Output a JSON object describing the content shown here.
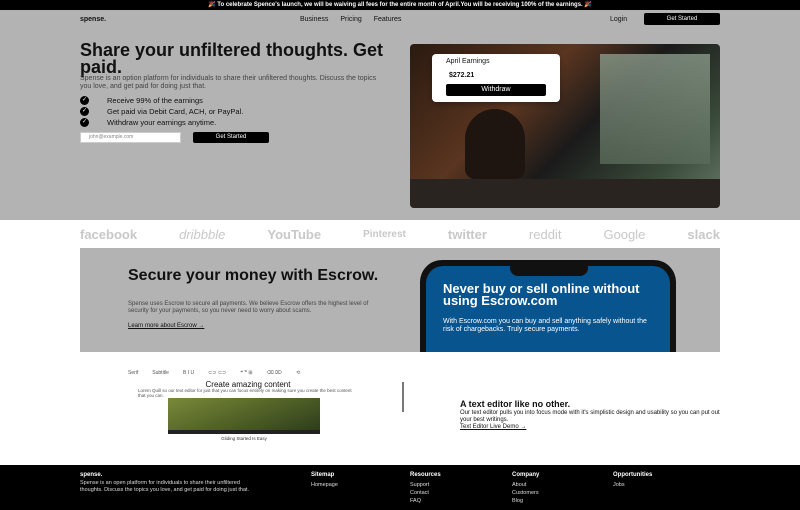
{
  "announcement": "🎉 To celebrate Spence's launch, we will be waiving all fees for the entire month of April.You will be receiving 100% of the earnings. 🎉",
  "nav": {
    "logo": "spense.",
    "links": [
      "Business",
      "Pricing",
      "Features"
    ],
    "login": "Login",
    "cta": "Get Started"
  },
  "hero": {
    "title": "Share your unfiltered thoughts. Get paid.",
    "subtitle": "Spense is an option platform for individuals to share their unfiltered thoughts. Discuss the topics you love, and get paid for doing just that.",
    "checks": [
      "Receive 99% of the earnings",
      "Get paid via Debit Card, ACH, or PayPal.",
      "Withdraw your earnings anytime."
    ],
    "email_placeholder": "john@example.com",
    "cta": "Get Started"
  },
  "earnings": {
    "title": "April Earnings",
    "value": "$272.21",
    "button": "Withdraw"
  },
  "brands": [
    "facebook",
    "dribbble",
    "YouTube",
    "Pinterest",
    "twitter",
    "reddit",
    "Google",
    "slack"
  ],
  "escrow": {
    "title": "Secure your money with Escrow.",
    "subtitle": "Spense uses Escrow to secure all payments. We believe Escrow offers the highest level of security for your payments, so you never need to worry about scams.",
    "link": "Learn more about Escrow →",
    "phone_title": "Never buy or sell online without using Escrow.com",
    "phone_sub": "With Escrow.com you can buy and sell anything safely without the risk of chargebacks. Truly secure payments."
  },
  "editor": {
    "toolbar": [
      "Serif",
      "Subtitle",
      "B I U",
      "⊂⊃ ⊂⊃",
      "❝ ❞ ⊞",
      "⌫ ⌦",
      "⟲"
    ],
    "heading": "Create amazing content",
    "body": "Lorem Quill so our text editor for just that you can focus entirely on making sure you create the best content that you can.",
    "caption": "Gliding Started Is Easy",
    "title": "A text editor like no other.",
    "subtitle": "Our text editor pulls you into focus mode with it's simplistic design and usability so you can put out your best writings.",
    "link": "Text Editor Live Demo →"
  },
  "footer": {
    "brand": "spense.",
    "desc": "Spense is an open platform for individuals to share their unfiltered thoughts. Discuss the topics you love, and get paid for doing just that.",
    "columns": [
      {
        "title": "Sitemap",
        "items": [
          "Homepage"
        ]
      },
      {
        "title": "Resources",
        "items": [
          "Support",
          "Contact",
          "FAQ"
        ]
      },
      {
        "title": "Company",
        "items": [
          "About",
          "Customers",
          "Blog"
        ]
      },
      {
        "title": "Opportunities",
        "items": [
          "Jobs"
        ]
      }
    ]
  }
}
